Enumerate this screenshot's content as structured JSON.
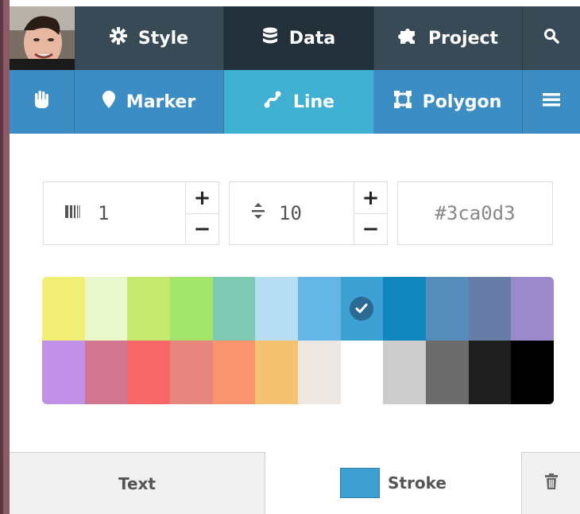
{
  "nav": {
    "tabs": [
      {
        "label": "Style",
        "icon": "gear-icon"
      },
      {
        "label": "Data",
        "icon": "database-icon"
      },
      {
        "label": "Project",
        "icon": "puzzle-icon"
      }
    ],
    "search_icon": "search-icon"
  },
  "toolbar": {
    "pan_icon": "hand-icon",
    "marker_label": "Marker",
    "line_label": "Line",
    "polygon_label": "Polygon",
    "menu_icon": "hamburger-icon",
    "active_tool": "Line"
  },
  "controls": {
    "stroke_width": "1",
    "marker_size": "10",
    "color_hex": "#3ca0d3"
  },
  "palette": {
    "selected": "#3ca0d3",
    "colors": [
      "#f1f075",
      "#eaf7ca",
      "#c5e96f",
      "#a3e46b",
      "#7ec9b1",
      "#b7ddf3",
      "#63b6e5",
      "#3ca0d3",
      "#1087bf",
      "#548cba",
      "#677da7",
      "#9c89cc",
      "#c091e6",
      "#d27591",
      "#f86767",
      "#e7857f",
      "#fa946e",
      "#f5c272",
      "#ede8e4",
      "#ffffff",
      "#cccccc",
      "#6c6c6c",
      "#1f1f1f",
      "#000000"
    ]
  },
  "bottom_tabs": {
    "text_label": "Text",
    "stroke_label": "Stroke",
    "stroke_color": "#3ca0d3",
    "trash_icon": "trash-icon"
  },
  "colors": {
    "nav_bg": "#394a57",
    "nav_active": "#22303a",
    "toolbar_bg": "#3b8dc4",
    "toolbar_active": "#3fb0d1"
  }
}
